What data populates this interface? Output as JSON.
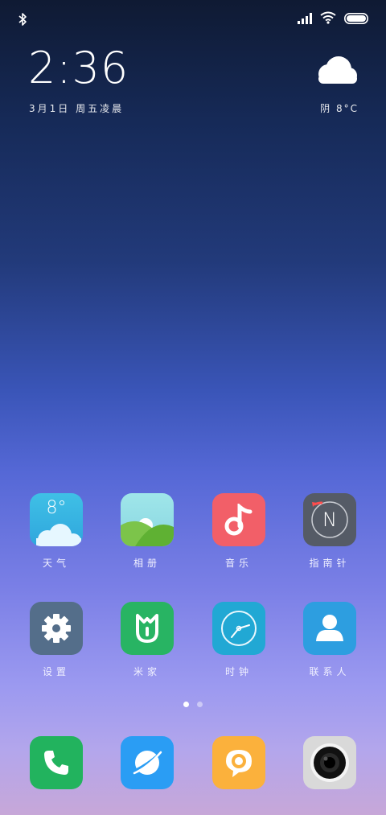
{
  "clock": {
    "time": "2:36",
    "date": "3月1日 周五凌晨"
  },
  "weather": {
    "text": "阴  8°C"
  },
  "home_apps": [
    {
      "label": "天气",
      "icon": "weather-icon",
      "temp": "8°"
    },
    {
      "label": "相册",
      "icon": "gallery-icon"
    },
    {
      "label": "音乐",
      "icon": "music-icon"
    },
    {
      "label": "指南针",
      "icon": "compass-icon",
      "letter": "N"
    },
    {
      "label": "设置",
      "icon": "settings-gear-icon"
    },
    {
      "label": "米家",
      "icon": "mijia-icon"
    },
    {
      "label": "时钟",
      "icon": "clock-icon"
    },
    {
      "label": "联系人",
      "icon": "contacts-icon"
    }
  ],
  "dock_apps": [
    {
      "icon": "phone-icon"
    },
    {
      "icon": "browser-icon"
    },
    {
      "icon": "messages-icon"
    },
    {
      "icon": "camera-icon"
    }
  ],
  "pager": {
    "pages": 2,
    "current": 1
  },
  "colors": {
    "weather_bg": "#3bb7e0",
    "music_bg": "#f25f68",
    "compass_bg": "#555b66",
    "settings_bg": "#546e8a",
    "mijia_bg": "#28b463",
    "clock_bg": "#21a8d4",
    "contacts_bg": "#2d9ee0",
    "phone_bg": "#22b35e",
    "browser_bg": "#2a9df4",
    "messages_bg": "#fbb13c",
    "camera_bg": "#d9d9d9"
  }
}
